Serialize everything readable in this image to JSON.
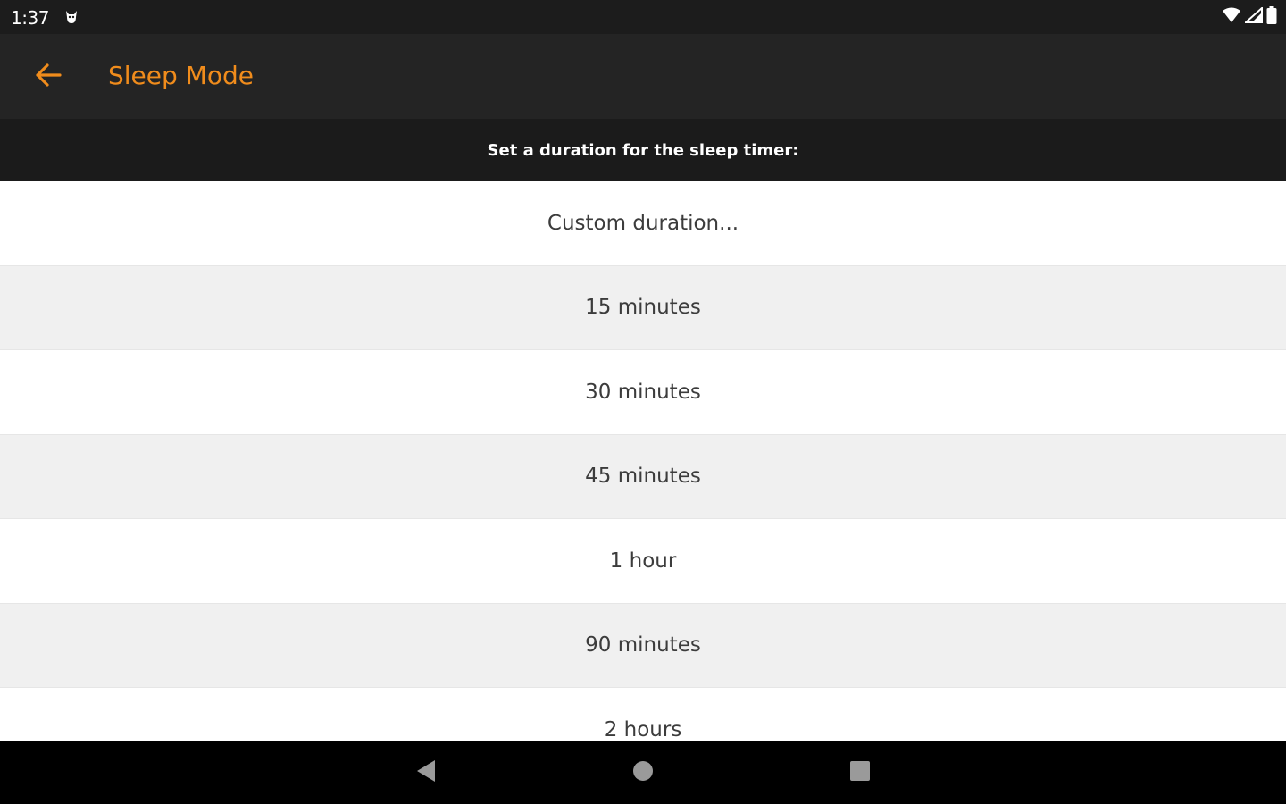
{
  "status_bar": {
    "time": "1:37",
    "notification_icon": "cat-icon",
    "right_icons": [
      "wifi-icon",
      "signal-icon",
      "battery-icon"
    ]
  },
  "app_bar": {
    "back_icon": "arrow-left-icon",
    "title": "Sleep Mode",
    "accent_color": "#f08c1c"
  },
  "subheader": {
    "text": "Set a duration for the sleep timer:"
  },
  "durations": [
    {
      "label": "Custom duration..."
    },
    {
      "label": "15 minutes"
    },
    {
      "label": "30 minutes"
    },
    {
      "label": "45 minutes"
    },
    {
      "label": "1 hour"
    },
    {
      "label": "90 minutes"
    },
    {
      "label": "2 hours"
    }
  ],
  "nav_bar": {
    "buttons": [
      "back-triangle-icon",
      "home-circle-icon",
      "recents-square-icon"
    ]
  }
}
